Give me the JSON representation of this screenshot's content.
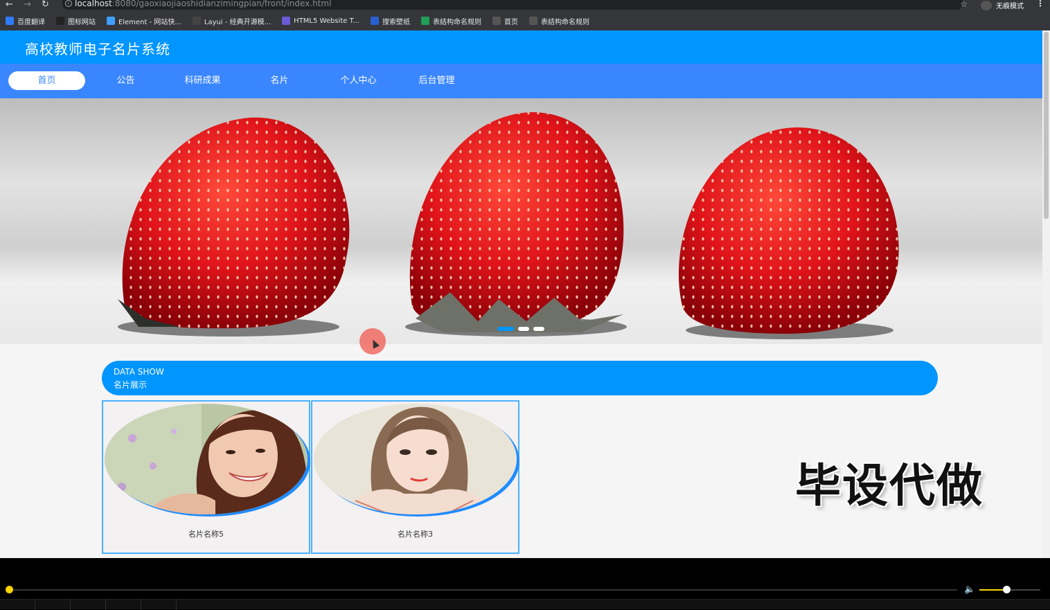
{
  "browser": {
    "url_host": "localhost",
    "url_path": ":8080/gaoxiaojiaoshidianzimingpian/front/index.html",
    "profile_label": "无痕模式",
    "bookmarks": [
      {
        "label": "百度翻译",
        "color": "#2f7bff",
        "icon": "translate-icon"
      },
      {
        "label": "图标网站",
        "color": "#222222",
        "icon": "flag-icon"
      },
      {
        "label": "Element - 网站快...",
        "color": "#409eff",
        "icon": "element-icon"
      },
      {
        "label": "Layui - 经典开源模...",
        "color": "#444444",
        "icon": "layui-icon"
      },
      {
        "label": "HTML5 Website T...",
        "color": "#6b5bd6",
        "icon": "html5-icon"
      },
      {
        "label": "搜索壁纸",
        "color": "#2a5fd0",
        "icon": "wallpaper-icon"
      },
      {
        "label": "表结构命名规则",
        "color": "#1e9e57",
        "icon": "sheet-icon"
      },
      {
        "label": "首页",
        "color": "#555555",
        "icon": "globe-icon"
      },
      {
        "label": "表结构命名规则",
        "color": "#555555",
        "icon": "globe-icon"
      }
    ]
  },
  "site": {
    "title": "高校教师电子名片系统",
    "nav": [
      "首页",
      "公告",
      "科研成果",
      "名片",
      "个人中心",
      "后台管理"
    ],
    "active_nav": "首页"
  },
  "carousel": {
    "slide_count": 3,
    "active_index": 0
  },
  "section": {
    "title_en": "DATA SHOW",
    "title_cn": "名片展示"
  },
  "cards": [
    {
      "name": "名片名称5"
    },
    {
      "name": "名片名称3"
    }
  ],
  "watermark": "毕设代做",
  "player": {
    "progress": 0.0,
    "volume": 0.4
  },
  "colors": {
    "header": "#0095ff",
    "navbar": "#3a86ff",
    "accent": "#ffd400"
  }
}
